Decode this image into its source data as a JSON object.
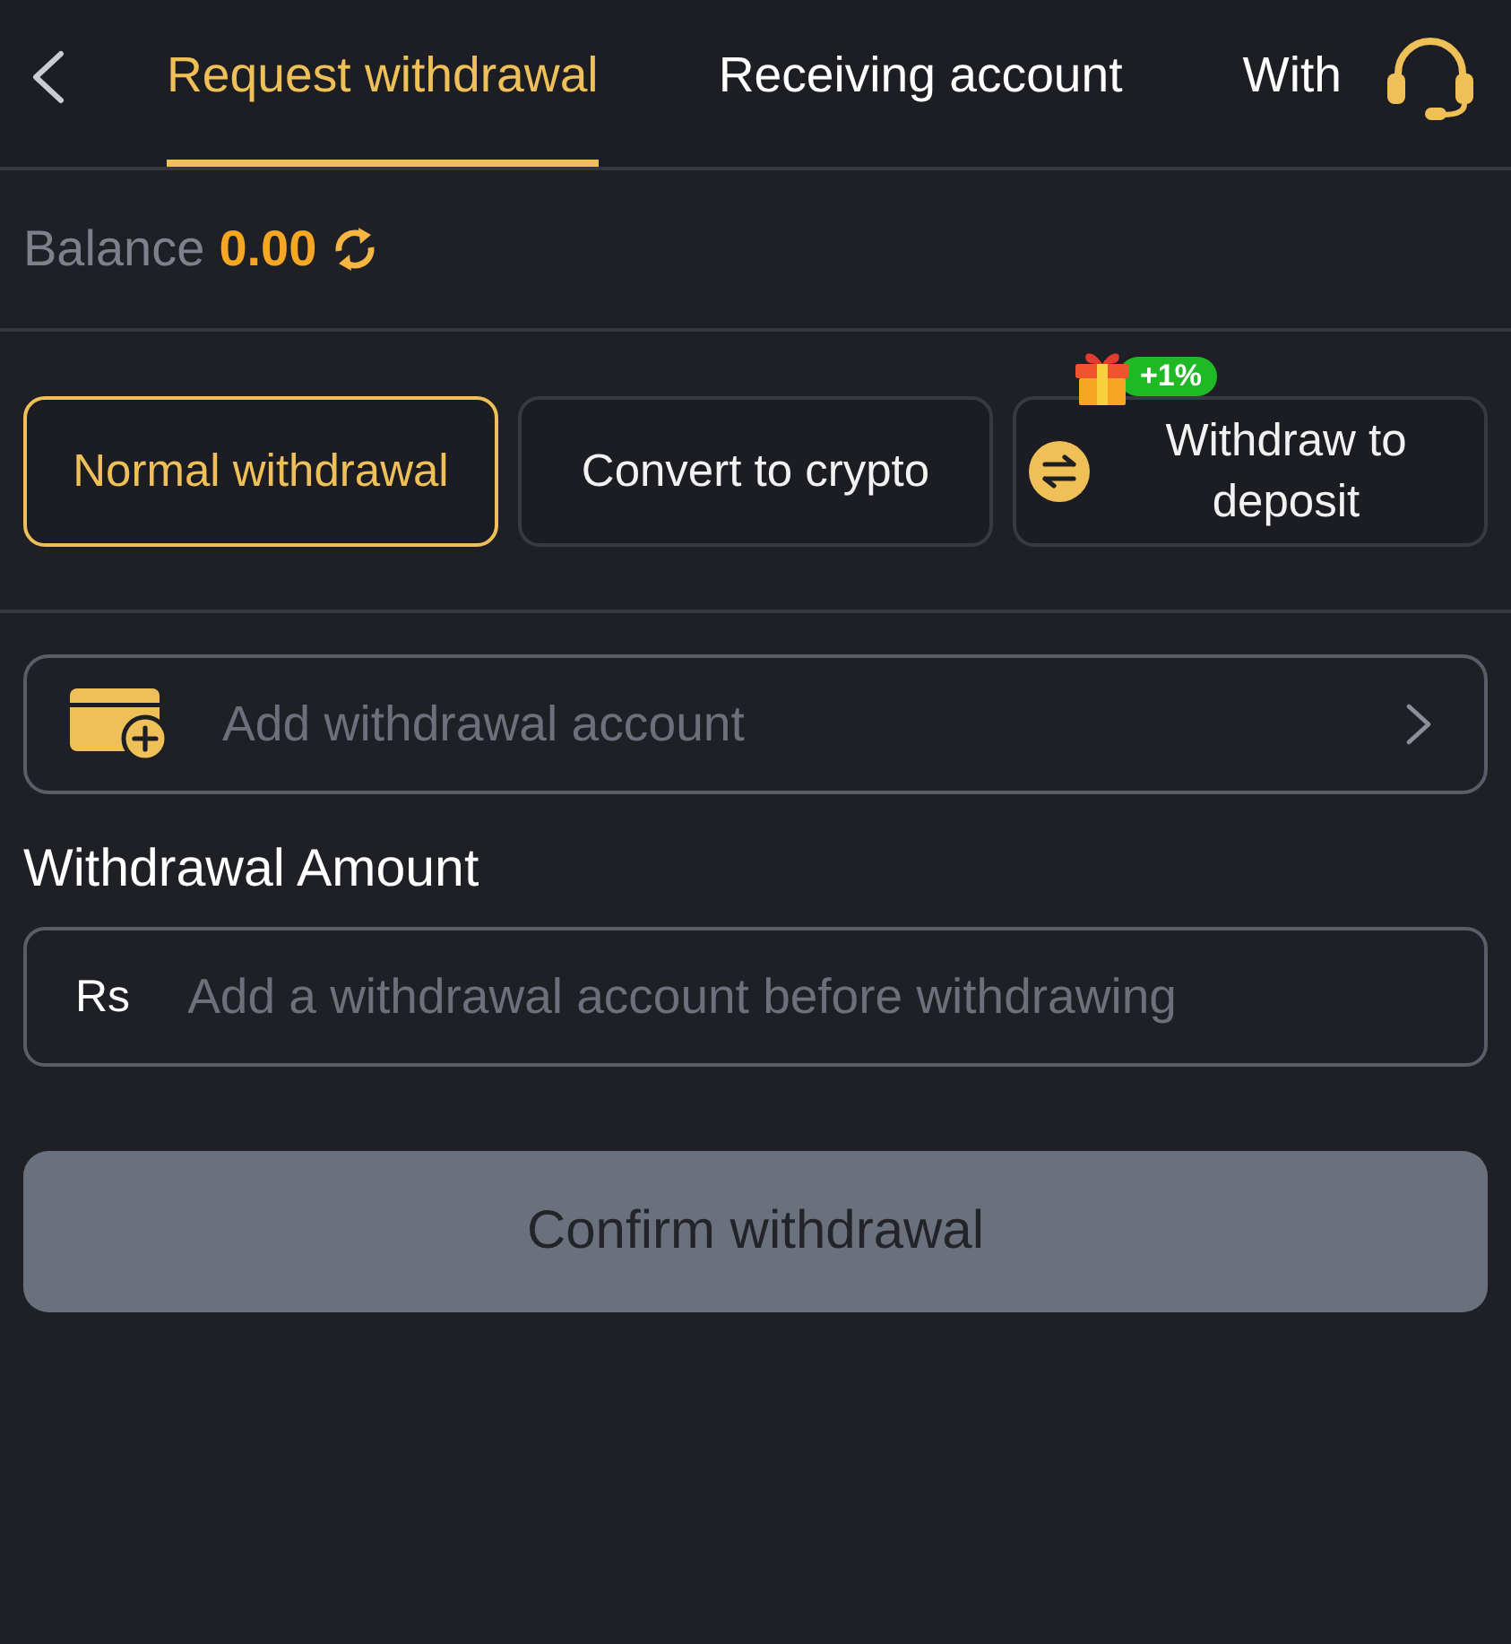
{
  "header": {
    "tabs": [
      {
        "label": "Request withdrawal",
        "selected": true
      },
      {
        "label": "Receiving account",
        "selected": false
      },
      {
        "label": "With",
        "selected": false
      }
    ]
  },
  "balance": {
    "label": "Balance",
    "amount": "0.00"
  },
  "methods": [
    {
      "kind": "plain",
      "label": "Normal withdrawal",
      "selected": true
    },
    {
      "kind": "plain",
      "label": "Convert to crypto",
      "selected": false
    },
    {
      "kind": "bonus",
      "label": "Withdraw to deposit",
      "selected": false,
      "badge": "+1%"
    }
  ],
  "account": {
    "label": "Add withdrawal account"
  },
  "amount": {
    "title": "Withdrawal Amount",
    "currency": "Rs",
    "placeholder": "Add a withdrawal account before withdrawing"
  },
  "confirm": {
    "label": "Confirm withdrawal",
    "disabled": true
  }
}
